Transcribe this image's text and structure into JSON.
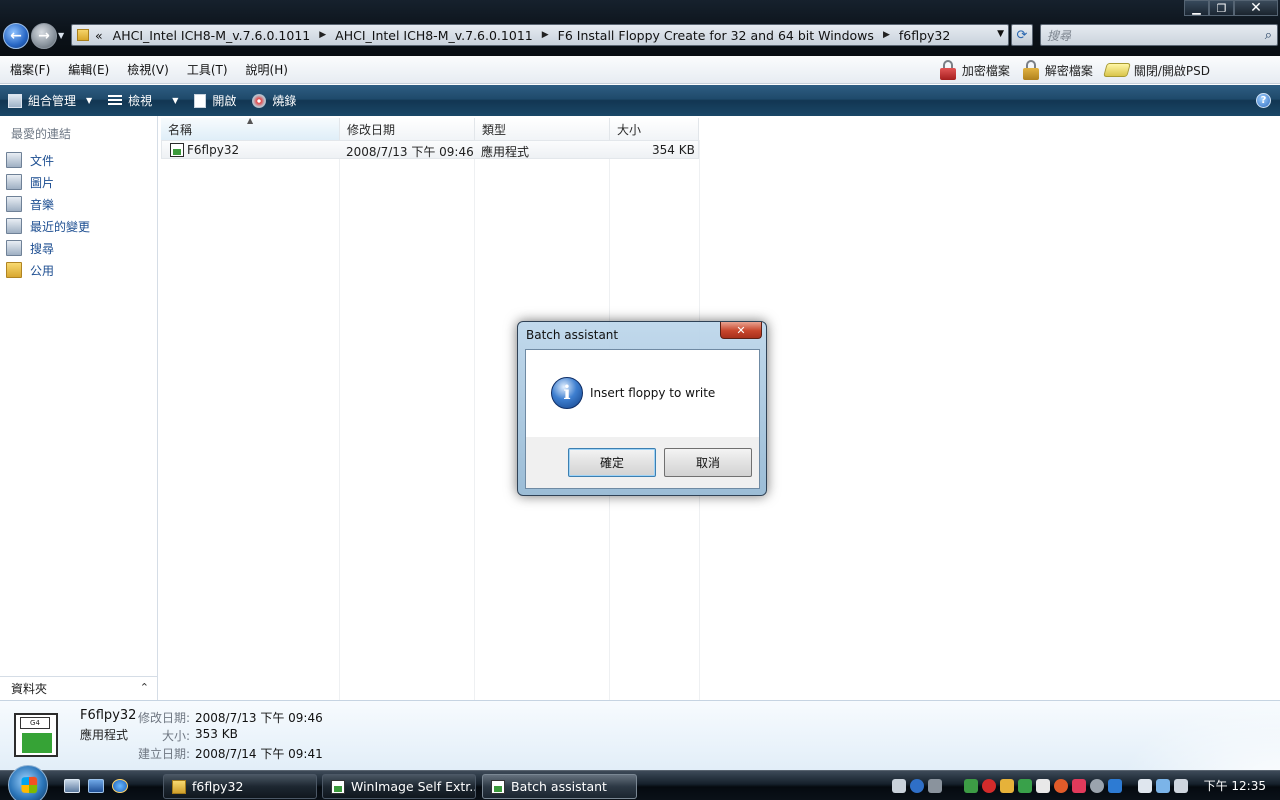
{
  "window": {
    "controls": {
      "minimize": "▁",
      "maximize": "❐",
      "close": "✕"
    }
  },
  "address_bar": {
    "overflow": "«",
    "segments": [
      "AHCI_Intel ICH8-M_v.7.6.0.1011",
      "AHCI_Intel ICH8-M_v.7.6.0.1011",
      "F6 Install Floppy Create for 32 and 64 bit Windows",
      "f6flpy32"
    ]
  },
  "search": {
    "placeholder": "搜尋"
  },
  "menu": {
    "items": [
      "檔案(F)",
      "編輯(E)",
      "檢視(V)",
      "工具(T)",
      "說明(H)"
    ],
    "right": {
      "encrypt": "加密檔案",
      "decrypt": "解密檔案",
      "psd": "關閉/開啟PSD"
    }
  },
  "toolbar": {
    "organize": "組合管理",
    "views": "檢視",
    "open": "開啟",
    "burn": "燒錄",
    "help": "?"
  },
  "nav": {
    "header": "最愛的連結",
    "items": [
      {
        "label": "文件",
        "icon": "documents-icon"
      },
      {
        "label": "圖片",
        "icon": "pictures-icon"
      },
      {
        "label": "音樂",
        "icon": "music-icon"
      },
      {
        "label": "最近的變更",
        "icon": "recent-changes-icon"
      },
      {
        "label": "搜尋",
        "icon": "searches-icon"
      },
      {
        "label": "公用",
        "icon": "public-folder-icon"
      }
    ],
    "folders_label": "資料夾"
  },
  "file_list": {
    "columns": [
      "名稱",
      "修改日期",
      "類型",
      "大小"
    ],
    "rows": [
      {
        "name": "F6flpy32",
        "modified": "2008/7/13 下午 09:46",
        "type": "應用程式",
        "size": "354 KB"
      }
    ]
  },
  "details": {
    "name": "F6flpy32",
    "type": "應用程式",
    "modified_label": "修改日期:",
    "modified": "2008/7/13 下午 09:46",
    "size_label": "大小:",
    "size": "353 KB",
    "created_label": "建立日期:",
    "created": "2008/7/14 下午 09:41",
    "icon_text": "G4"
  },
  "dialog": {
    "title": "Batch assistant",
    "close": "✕",
    "message": "Insert floppy to write",
    "ok": "確定",
    "cancel": "取消"
  },
  "taskbar": {
    "tasks": [
      {
        "label": "f6flpy32"
      },
      {
        "label": "WinImage Self Extr..."
      },
      {
        "label": "Batch assistant"
      }
    ],
    "clock": "下午 12:35"
  },
  "colors": {
    "link_blue": "#1d4e91",
    "toolbar_bg": "#1f4a6b",
    "dialog_close_red": "#c7452b"
  }
}
